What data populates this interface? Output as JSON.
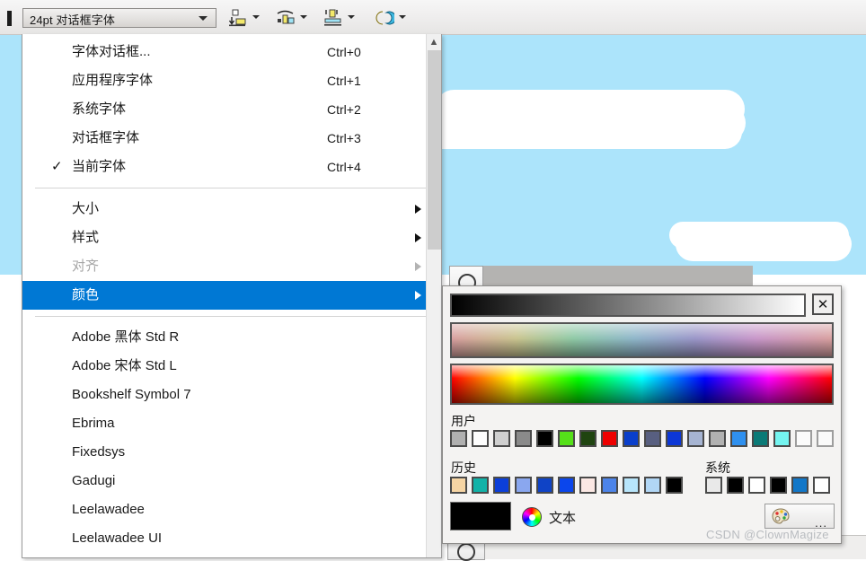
{
  "toolbar": {
    "font_combo": {
      "value": "24pt 对话框字体",
      "dropdown_icon": "chevron-down-icon"
    },
    "buttons": [
      {
        "name": "align-bottom-button",
        "icon": "align-bottom-icon",
        "dropdown_icon": "chevron-down-icon"
      },
      {
        "name": "align-top-button",
        "icon": "align-top-icon",
        "dropdown_icon": "chevron-down-icon"
      },
      {
        "name": "center-vertical-button",
        "icon": "center-vertical-icon",
        "dropdown_icon": "chevron-down-icon"
      },
      {
        "name": "swap-colors-button",
        "icon": "swap-colors-icon",
        "dropdown_icon": "chevron-down-icon"
      }
    ]
  },
  "menu": {
    "commands": [
      {
        "label": "字体对话框...",
        "accel": "Ctrl+0",
        "checked": false
      },
      {
        "label": "应用程序字体",
        "accel": "Ctrl+1",
        "checked": false
      },
      {
        "label": "系统字体",
        "accel": "Ctrl+2",
        "checked": false
      },
      {
        "label": "对话框字体",
        "accel": "Ctrl+3",
        "checked": false
      },
      {
        "label": "当前字体",
        "accel": "Ctrl+4",
        "checked": true
      }
    ],
    "check_glyph": "✓",
    "submenus": [
      {
        "label": "大小",
        "disabled": false,
        "selected": false
      },
      {
        "label": "样式",
        "disabled": false,
        "selected": false
      },
      {
        "label": "对齐",
        "disabled": true,
        "selected": false
      },
      {
        "label": "颜色",
        "disabled": false,
        "selected": true
      }
    ],
    "fonts": [
      "Adobe 黑体 Std R",
      "Adobe 宋体 Std L",
      "Bookshelf Symbol 7",
      "Ebrima",
      "Fixedsys",
      "Gadugi",
      "Leelawadee",
      "Leelawadee UI"
    ],
    "scrollbar": {
      "up_arrow_icon": "chevron-up-icon"
    },
    "highlight_color": "#0078d4"
  },
  "color_panel": {
    "close_label": "✕",
    "gradients": [
      {
        "name": "grayscale-gradient",
        "from": "#000000",
        "to": "#ffffff"
      },
      {
        "name": "muted-spectrum-gradient",
        "from": "#d8a0a0",
        "to": "#d8a0a0"
      },
      {
        "name": "hue-spectrum-gradient",
        "from": "#ff0000",
        "to": "#ff0000"
      }
    ],
    "user_label": "用户",
    "user_swatches": [
      "#b0b0b0",
      "#fdfdfd",
      "#cfcfcf",
      "#8a8a8a",
      "#000000",
      "#55e019",
      "#1f4410",
      "#ee0000",
      "#0a3fcb",
      "#585f80",
      "#0c37d6",
      "#a6b4d2",
      "#b1b1b1",
      "#2f90ef",
      "#0b7a77",
      "#74f4f0",
      "#fbfbfb",
      "#fafafa"
    ],
    "history_label": "历史",
    "history_swatches": [
      "#f6d5a4",
      "#12b2a8",
      "#0c3fd9",
      "#8aa7ef",
      "#0f43c6",
      "#0b46ec",
      "#fbe8e4",
      "#4d84e9",
      "#b8e5fb",
      "#b1d6f5",
      "#000000"
    ],
    "system_label": "系统",
    "system_swatches": [
      "#e9e9e9",
      "#000000",
      "#ffffff",
      "#000000",
      "#1277c8",
      "#ffffff"
    ],
    "preview_color": "#000000",
    "text_label": "文本",
    "wheel_icon": "color-wheel-icon",
    "more_button": {
      "label": "...",
      "icon": "palette-icon"
    }
  },
  "watermark": "CSDN @ClownMagize"
}
